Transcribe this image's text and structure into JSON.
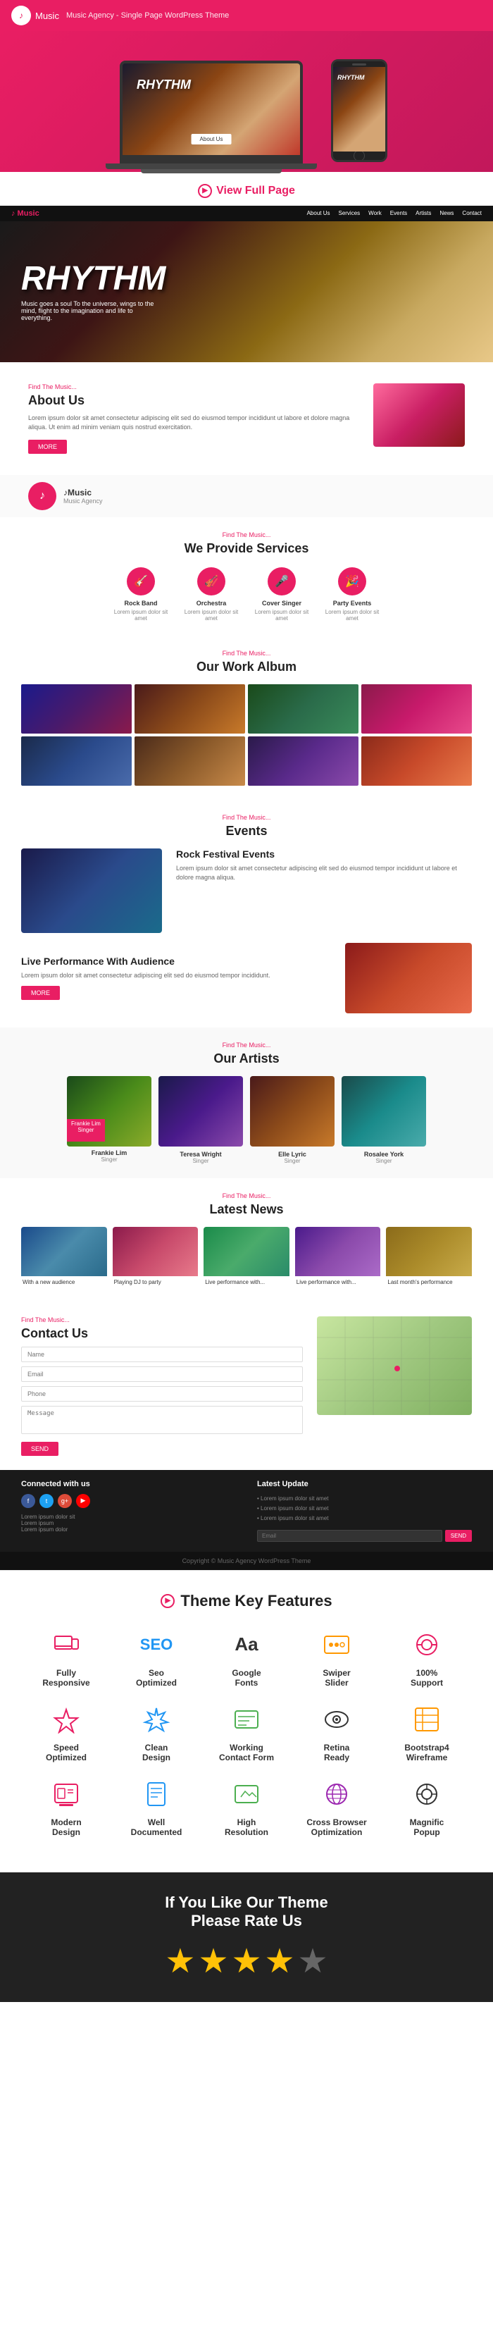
{
  "header": {
    "logo_text": "Music",
    "tagline": "Music Agency - Single Page WordPress Theme"
  },
  "view_full_page": {
    "label": "View Full Page"
  },
  "hero": {
    "title": "RHYTHM",
    "subtitle": "Music goes a soul To the universe, wings to the mind, flight to the imagination and life to everything.",
    "nav_links": [
      "About Us",
      "Services",
      "Work",
      "Events",
      "Artists",
      "News",
      "Contact"
    ]
  },
  "about": {
    "eyebrow": "Find The Music...",
    "title": "About Us",
    "body": "Lorem ipsum dolor sit amet consectetur adipiscing elit sed do eiusmod tempor incididunt ut labore et dolore magna aliqua. Ut enim ad minim veniam quis nostrud exercitation.",
    "button": "MORE"
  },
  "services": {
    "eyebrow": "Find The Music...",
    "title": "We Provide Services",
    "items": [
      {
        "name": "Rock Band",
        "icon": "🎸"
      },
      {
        "name": "Orchestra",
        "icon": "🎻"
      },
      {
        "name": "Cover Singer",
        "icon": "🎤"
      },
      {
        "name": "Party Events",
        "icon": "🎉"
      }
    ]
  },
  "album": {
    "eyebrow": "Find The Music...",
    "title": "Our Work Album"
  },
  "events": {
    "eyebrow": "Find The Music...",
    "title": "Events",
    "items": [
      {
        "title": "Rock Festival Events",
        "desc": "Lorem ipsum dolor sit amet consectetur adipiscing elit sed do eiusmod tempor incididunt ut labore et dolore magna aliqua."
      },
      {
        "title": "Live Performance With Audience",
        "desc": "Lorem ipsum dolor sit amet consectetur adipiscing elit sed do eiusmod tempor incididunt.",
        "button": "MORE"
      }
    ]
  },
  "artists": {
    "eyebrow": "Find The Music...",
    "title": "Our Artists",
    "items": [
      {
        "name": "Frankie Lim",
        "role": "Singer"
      },
      {
        "name": "Teresa Wright",
        "role": "Singer"
      },
      {
        "name": "Elle Lyric",
        "role": "Singer"
      },
      {
        "name": "Rosalee York",
        "role": "Singer"
      }
    ],
    "featured": "Frankie Lim\nSinger"
  },
  "news": {
    "eyebrow": "Find The Music...",
    "title": "Latest News",
    "items": [
      {
        "caption": "With a new audience"
      },
      {
        "caption": "Playing DJ to party"
      },
      {
        "caption": "Live performance with..."
      },
      {
        "caption": "Live performance with..."
      },
      {
        "caption": "Last month's performance"
      }
    ]
  },
  "contact": {
    "eyebrow": "Find The Music...",
    "title": "Contact Us",
    "fields": {
      "name": {
        "placeholder": "Name"
      },
      "email": {
        "placeholder": "Email"
      },
      "phone": {
        "placeholder": "Phone"
      },
      "message": {
        "placeholder": "Message"
      }
    },
    "button": "SEND"
  },
  "footer": {
    "connected_title": "Connected with us",
    "latest_title": "Latest Update",
    "social": [
      "f",
      "t",
      "g+",
      "▶"
    ],
    "copyright": "Copyright © Music Agency WordPress Theme"
  },
  "features": {
    "title": "Theme Key Features",
    "items": [
      {
        "name": "Fully\nResponsive",
        "icon": "📱",
        "color": "pink"
      },
      {
        "name": "Seo\nOptimized",
        "icon": "SEO",
        "color": "blue"
      },
      {
        "name": "Google\nFonts",
        "icon": "Aa",
        "color": "dark"
      },
      {
        "name": "Swiper\nSlider",
        "icon": "🎛",
        "color": "orange"
      },
      {
        "name": "100%\nSupport",
        "icon": "🔍",
        "color": "pink"
      },
      {
        "name": "Speed\nOptimized",
        "icon": "🚀",
        "color": "pink"
      },
      {
        "name": "Clean\nDesign",
        "icon": "🧪",
        "color": "blue"
      },
      {
        "name": "Working\nContact Form",
        "icon": "📄",
        "color": "green"
      },
      {
        "name": "Retina\nReady",
        "icon": "👁",
        "color": "dark"
      },
      {
        "name": "Bootstrap4\nWireframe",
        "icon": "🎰",
        "color": "orange"
      },
      {
        "name": "Modern\nDesign",
        "icon": "🖥",
        "color": "pink"
      },
      {
        "name": "Well\nDocumented",
        "icon": "📋",
        "color": "blue"
      },
      {
        "name": "High\nResolution",
        "icon": "🖼",
        "color": "green"
      },
      {
        "name": "Cross Browser\nOptimization",
        "icon": "🌐",
        "color": "purple"
      },
      {
        "name": "Magnific\nPopup",
        "icon": "🔎",
        "color": "dark"
      }
    ]
  },
  "rate": {
    "title": "If You Like Our Theme\nPlease Rate Us",
    "stars": [
      true,
      true,
      true,
      true,
      false
    ]
  }
}
